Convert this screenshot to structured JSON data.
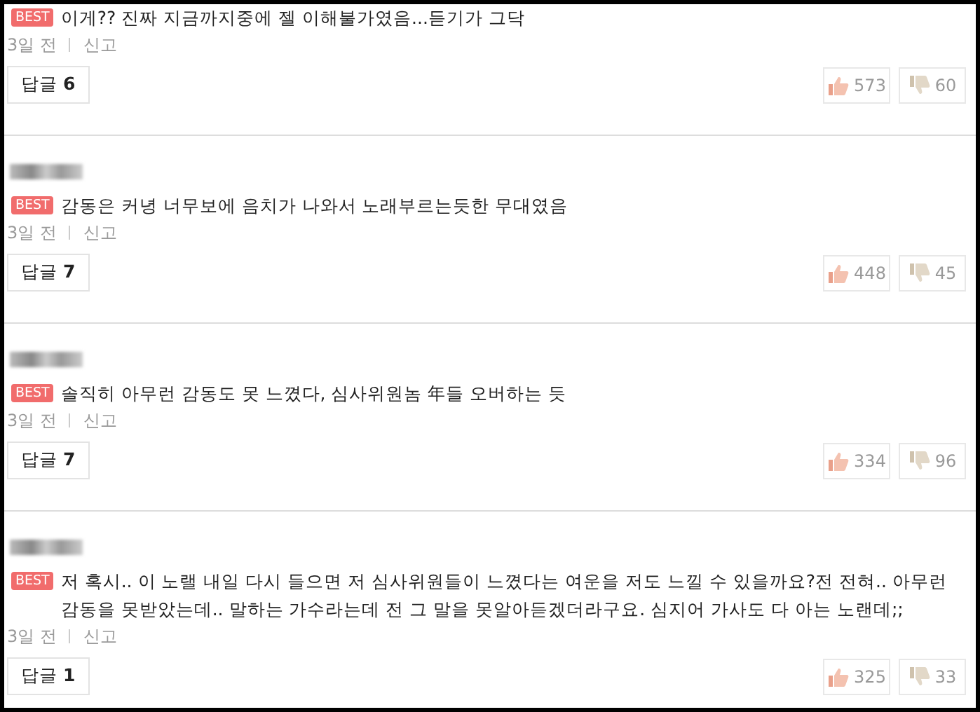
{
  "comments": [
    {
      "blurred_name": false,
      "badge": "BEST",
      "text": "이게?? 진짜 지금까지중에 젤 이해불가였음...듣기가 그닥",
      "time": "3일 전",
      "report": "신고",
      "reply_label": "답글",
      "reply_count": "6",
      "likes": "573",
      "dislikes": "60"
    },
    {
      "blurred_name": true,
      "badge": "BEST",
      "text": "감동은 커녕 너무보에 음치가 나와서 노래부르는듯한 무대였음",
      "time": "3일 전",
      "report": "신고",
      "reply_label": "답글",
      "reply_count": "7",
      "likes": "448",
      "dislikes": "45"
    },
    {
      "blurred_name": true,
      "badge": "BEST",
      "text": "솔직히 아무런 감동도 못 느꼈다, 심사위원놈 年들 오버하는 듯",
      "time": "3일 전",
      "report": "신고",
      "reply_label": "답글",
      "reply_count": "7",
      "likes": "334",
      "dislikes": "96"
    },
    {
      "blurred_name": true,
      "badge": "BEST",
      "text": "저 혹시.. 이 노랠 내일 다시 들으면 저 심사위원들이 느꼈다는 여운을 저도 느낄 수 있을까요?전 전혀.. 아무런 감동을 못받았는데.. 말하는 가수라는데 전 그 말을 못알아듣겠더라구요. 심지어 가사도 다 아는 노랜데;;",
      "time": "3일 전",
      "report": "신고",
      "reply_label": "답글",
      "reply_count": "1",
      "likes": "325",
      "dislikes": "33"
    }
  ]
}
